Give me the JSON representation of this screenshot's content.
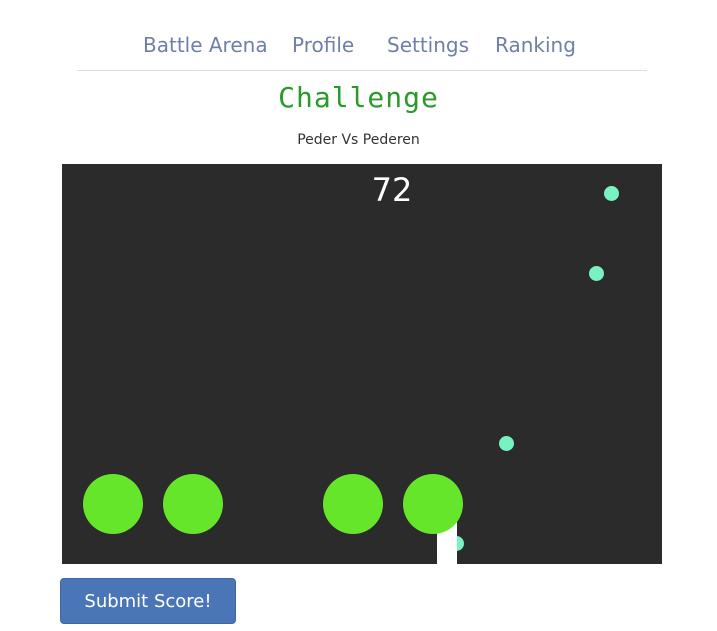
{
  "nav": {
    "items": [
      {
        "label": "Battle Arena"
      },
      {
        "label": "Profile"
      },
      {
        "label": "Settings"
      },
      {
        "label": "Ranking"
      }
    ]
  },
  "page": {
    "title": "Challenge",
    "subtitle": "Peder Vs Pederen"
  },
  "game": {
    "score": "72",
    "colors": {
      "board": "#2b2b2b",
      "player": "#66e62a",
      "ball": "#78f2c0",
      "trail": "#ffffff"
    }
  },
  "actions": {
    "submit_label": "Submit Score!"
  },
  "colors": {
    "nav_link": "#6f7fa8",
    "title": "#2a9a2a",
    "button": "#4a76b8"
  }
}
